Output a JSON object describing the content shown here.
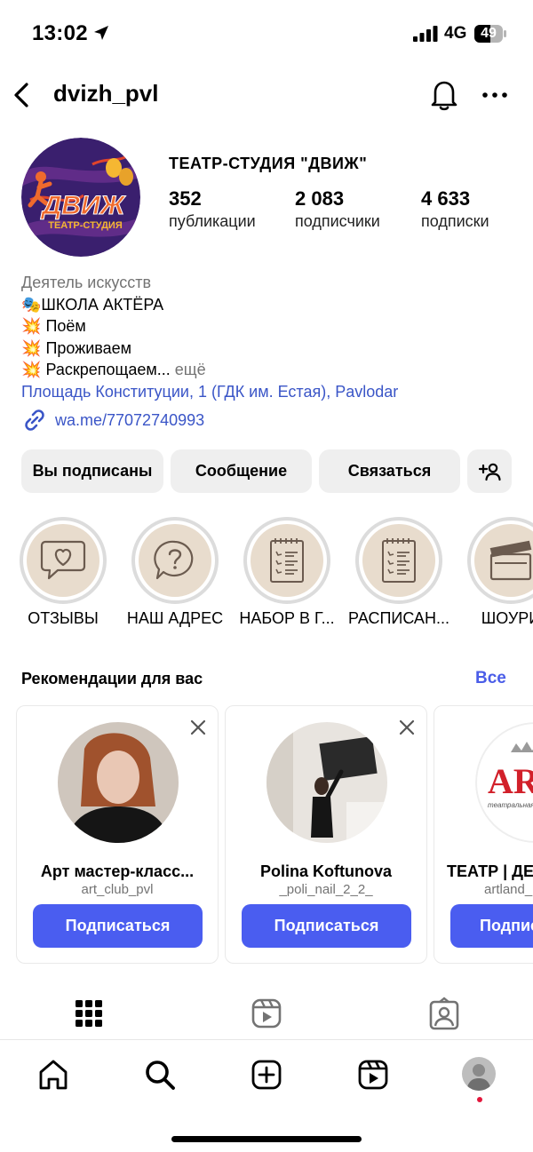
{
  "status_bar": {
    "time": "13:02",
    "network": "4G",
    "battery": "49"
  },
  "header": {
    "username": "dvizh_pvl"
  },
  "profile": {
    "name": "ТЕАТР-СТУДИЯ \"ДВИЖ\"",
    "avatar_text": "ДВИЖ",
    "avatar_subtext": "ТЕАТР-СТУДИЯ",
    "stats": [
      {
        "value": "352",
        "label": "публикации"
      },
      {
        "value": "2 083",
        "label": "подписчики"
      },
      {
        "value": "4 633",
        "label": "подписки"
      }
    ]
  },
  "bio": {
    "category": "Деятель искусств",
    "lines": [
      {
        "emoji": "🎭",
        "text": "ШКОЛА АКТЁРА"
      },
      {
        "emoji": "💥",
        "text": "Поём"
      },
      {
        "emoji": "💥",
        "text": "Проживаем"
      },
      {
        "emoji": "💥",
        "text": "Раскрепощаем..."
      }
    ],
    "more": "ещё",
    "address": "Площадь Конституции, 1 (ГДК им. Естая), Pavlodar",
    "link": "wa.me/77072740993"
  },
  "buttons": {
    "following": "Вы подписаны",
    "message": "Сообщение",
    "contact": "Связаться"
  },
  "highlights": [
    {
      "label": "ОТЗЫВЫ",
      "icon": "speech-heart-icon"
    },
    {
      "label": "НАШ АДРЕС",
      "icon": "question-bubble-icon"
    },
    {
      "label": "НАБОР В Г...",
      "icon": "checklist-icon"
    },
    {
      "label": "РАСПИСАН...",
      "icon": "checklist-icon"
    },
    {
      "label": "ШОУРИ",
      "icon": "clapperboard-icon"
    }
  ],
  "recommendations": {
    "title": "Рекомендации для вас",
    "see_all": "Все",
    "follow_label": "Подписаться",
    "cards": [
      {
        "name": "Арт мастер-класс...",
        "handle": "art_club_pvl"
      },
      {
        "name": "Polina Koftunova",
        "handle": "_poli_nail_2_2_"
      },
      {
        "name": "ТЕАТР | ДЕ",
        "handle": "artland_",
        "logo_text": "AR",
        "logo_subtext": "театральная мастер"
      }
    ]
  },
  "colors": {
    "accent": "#4a5df0",
    "link": "#3a55c7",
    "notification_dot": "#e3163b"
  }
}
